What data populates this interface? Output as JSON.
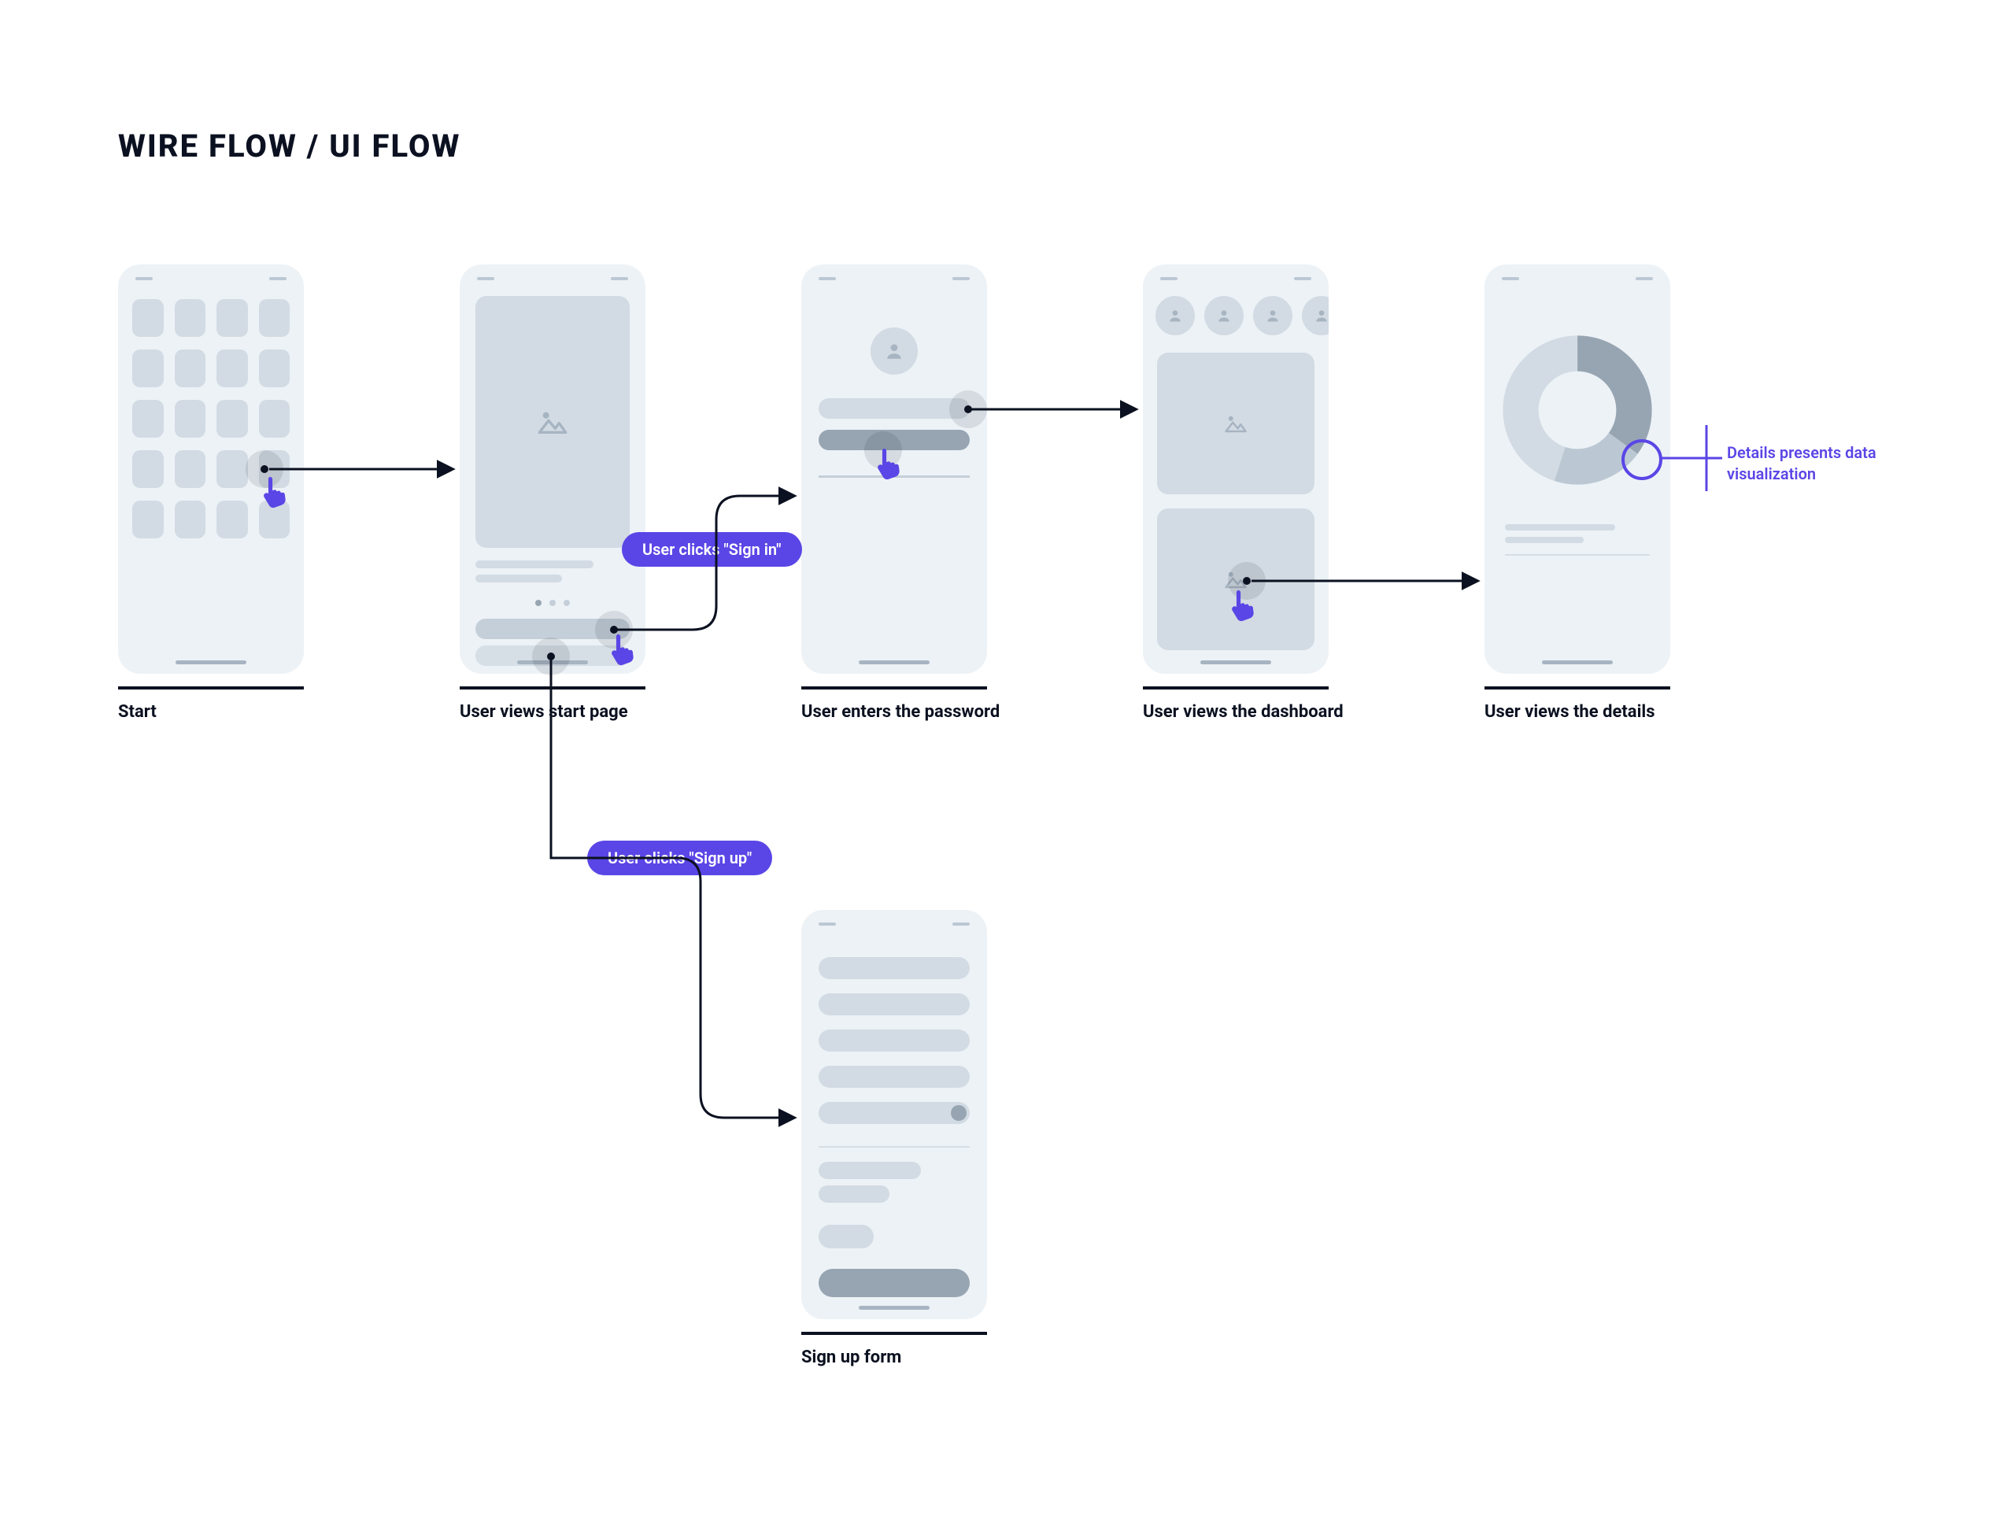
{
  "title": "WIRE FLOW / UI FLOW",
  "screens": {
    "start": {
      "caption": "Start"
    },
    "startpage": {
      "caption": "User views start page"
    },
    "password": {
      "caption": "User enters the password"
    },
    "dashboard": {
      "caption": "User views  the dashboard"
    },
    "details": {
      "caption": "User views  the details"
    },
    "signup": {
      "caption": "Sign up form"
    }
  },
  "labels": {
    "signin_click": "User clicks \"Sign in\"",
    "signup_click": "User clicks \"Sign up\""
  },
  "annotation": {
    "details": "Details presents data visualization"
  },
  "colors": {
    "accent": "#5A46E6",
    "phone_bg": "#EDF2F6",
    "wf_light": "#D2DBE3",
    "wf_dark": "#97A5B3"
  }
}
